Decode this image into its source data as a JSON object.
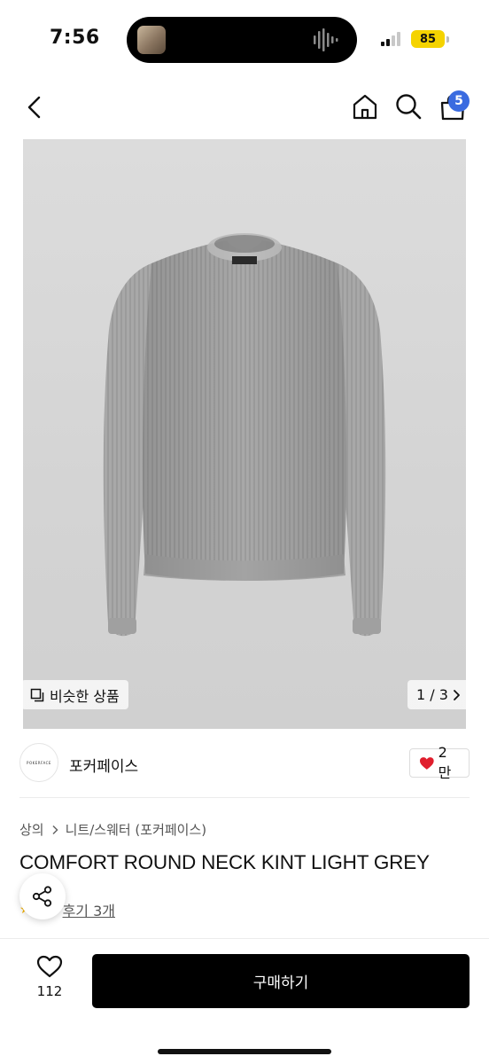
{
  "status_bar": {
    "time": "7:56",
    "battery": "85",
    "battery_color": "#f5d300"
  },
  "nav": {
    "back_icon": "chevron-left-icon",
    "home_icon": "home-icon",
    "search_icon": "search-icon",
    "cart_icon": "shopping-bag-icon",
    "cart_badge": "5",
    "badge_color": "#3a6be0"
  },
  "gallery": {
    "similar_label": "비슷한 상품",
    "page_indicator": "1 / 3"
  },
  "shop": {
    "name": "포커페이스",
    "avatar_text": "POKERFACE",
    "likes": "2만"
  },
  "product": {
    "breadcrumb": [
      "상의",
      "니트/스웨터 (포커페이스)"
    ],
    "title": "COMFORT ROUND NECK KINT LIGHT GREY",
    "review_link": "후기 3개"
  },
  "bottom_bar": {
    "wish_count": "112",
    "buy_label": "구매하기"
  }
}
